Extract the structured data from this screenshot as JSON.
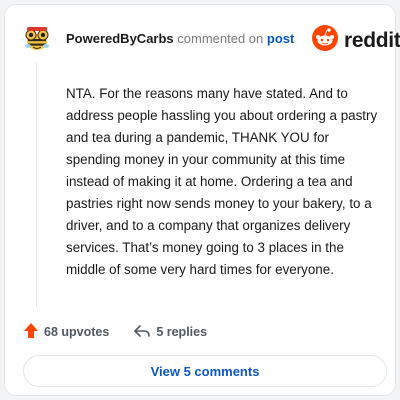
{
  "header": {
    "username": "PoweredByCarbs",
    "action_text": " commented on ",
    "post_link": "post",
    "brand": "reddit"
  },
  "comment": {
    "body": "NTA. For the reasons many have stated. And to address people hassling you about ordering a pastry and tea during a pandemic, THANK YOU for spending money in your community at this time instead of making it at home. Ordering a tea and pastries right now sends money to your bakery, to a driver, and to a company that organizes delivery services. That’s money going to 3 places in the middle of some very hard times for everyone."
  },
  "actions": {
    "upvotes_label": "68 upvotes",
    "replies_label": "5 replies"
  },
  "footer": {
    "view_comments_label": "View 5 comments"
  },
  "icons": {
    "avatar": "bee-avatar-icon",
    "brand_logo": "reddit-snoo-icon",
    "upvote": "upvote-arrow-icon",
    "reply": "reply-arrow-icon"
  },
  "colors": {
    "brand_orange": "#ff4500",
    "link_blue": "#0b56c5",
    "text": "#1a1a1b",
    "muted": "#7c7c7c"
  }
}
